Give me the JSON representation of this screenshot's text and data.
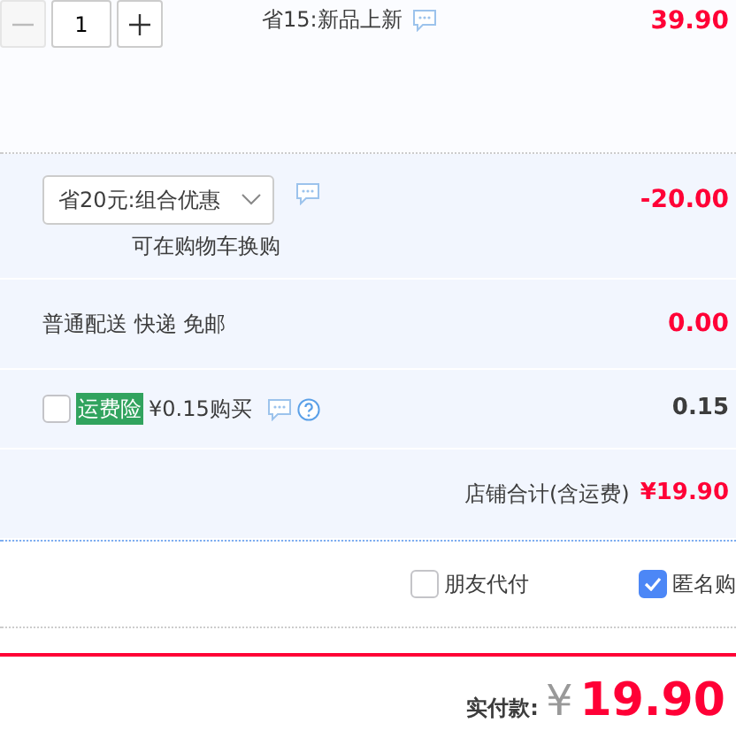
{
  "item": {
    "quantity": "1",
    "minus_disabled": true,
    "promo": "省15:新品上新",
    "price": "39.90"
  },
  "discount": {
    "value": "省20元:组合优惠",
    "hint": "可在购物车换购",
    "amount": "-20.00"
  },
  "shipping": {
    "text": "普通配送 快递 免邮",
    "amount": "0.00"
  },
  "insurance": {
    "checked": false,
    "tag": "运费险",
    "text": "¥0.15购买",
    "amount": "0.15"
  },
  "store_total": {
    "label": "店铺合计(含运费)",
    "amount": "¥19.90"
  },
  "options": [
    {
      "label": "朋友代付",
      "checked": false
    },
    {
      "label": "匿名购",
      "checked": true
    }
  ],
  "payment": {
    "label": "实付款:",
    "currency": "¥",
    "amount": "19.90"
  }
}
